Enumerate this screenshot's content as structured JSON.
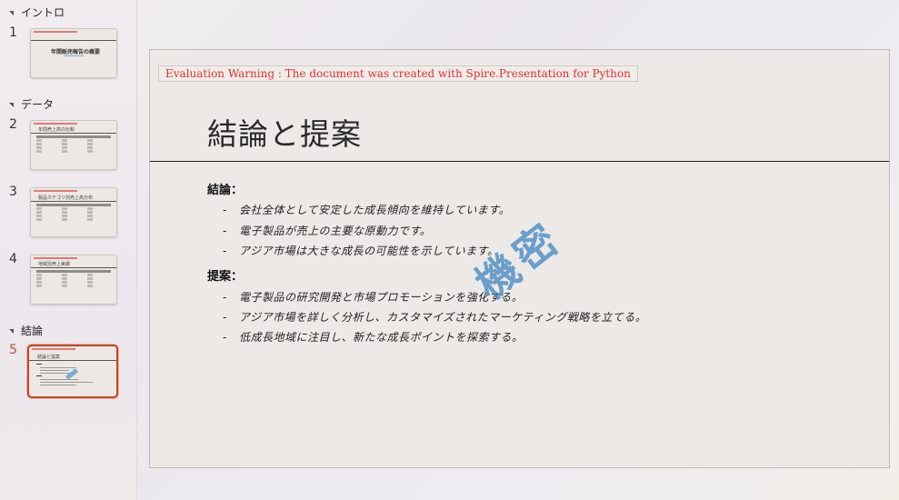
{
  "sections": [
    {
      "label": "イントロ"
    },
    {
      "label": "データ"
    },
    {
      "label": "結論"
    }
  ],
  "slides": [
    {
      "number": "1",
      "thumb_title": "年間販売報告の概要"
    },
    {
      "number": "2",
      "thumb_title": "年間売上高の比較"
    },
    {
      "number": "3",
      "thumb_title": "製品カテゴリ別売上高分布"
    },
    {
      "number": "4",
      "thumb_title": "地域別売上実績"
    },
    {
      "number": "5",
      "thumb_title": "結論と提案"
    }
  ],
  "current_slide": {
    "warning": "Evaluation Warning : The document was created with Spire.Presentation for Python",
    "title": "結論と提案",
    "conclusion_heading": "結論：",
    "conclusion_items": [
      "会社全体として安定した成長傾向を維持しています。",
      "電子製品が売上の主要な原動力です。",
      "アジア市場は大きな成長の可能性を示しています。"
    ],
    "proposal_heading": "提案：",
    "proposal_items": [
      "電子製品の研究開発と市場プロモーションを強化する。",
      "アジア市場を詳しく分析し、カスタマイズされたマーケティング戦略を立てる。",
      "低成長地域に注目し、新たな成長ポイントを探索する。"
    ],
    "watermark": "機密",
    "bullet": "-"
  },
  "colors": {
    "selection": "#c0462d",
    "warning": "#e0332f",
    "watermark": "#3f86c2"
  }
}
